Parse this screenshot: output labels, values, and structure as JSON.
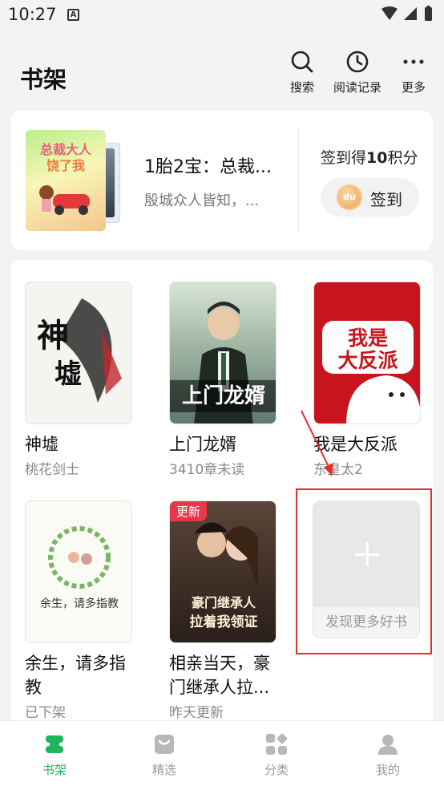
{
  "status_bar": {
    "time": "10:27",
    "notification_letter": "A"
  },
  "header": {
    "title": "书架",
    "actions": [
      {
        "label": "搜索",
        "icon": "search-icon"
      },
      {
        "label": "阅读记录",
        "icon": "clock-icon"
      },
      {
        "label": "更多",
        "icon": "more-dots-icon"
      }
    ]
  },
  "recent": {
    "title": "1胎2宝：总裁...",
    "subtitle": "殷城众人皆知，...",
    "cover_text": "总裁大人 饶了我"
  },
  "checkin": {
    "prefix": "签到得",
    "points": "10",
    "suffix": "积分",
    "button_label": "签到",
    "coin_text": "du"
  },
  "books": [
    {
      "title": "神墟",
      "status": "桃花剑士",
      "cover_text": "神墟"
    },
    {
      "title": "上门龙婿",
      "status": "3410章未读",
      "cover_text": "上门龙婿"
    },
    {
      "title": "我是大反派",
      "status": "东皇太2",
      "cover_text": "我是大反派"
    },
    {
      "title": "余生，请多指教",
      "status": "已下架",
      "cover_text": "余生，请多指教"
    },
    {
      "title": "相亲当天，豪门继承人拉...",
      "status": "昨天更新",
      "cover_text": "豪门继承人 拉着我领证",
      "badge": "更新"
    }
  ],
  "discover": {
    "label": "发现更多好书"
  },
  "tabs": [
    {
      "label": "书架",
      "icon": "bookshelf-icon",
      "active": true
    },
    {
      "label": "精选",
      "icon": "featured-icon",
      "active": false
    },
    {
      "label": "分类",
      "icon": "category-icon",
      "active": false
    },
    {
      "label": "我的",
      "icon": "profile-icon",
      "active": false
    }
  ],
  "colors": {
    "accent": "#21b45c",
    "highlight_box": "#e03030",
    "badge": "#e8374a"
  }
}
